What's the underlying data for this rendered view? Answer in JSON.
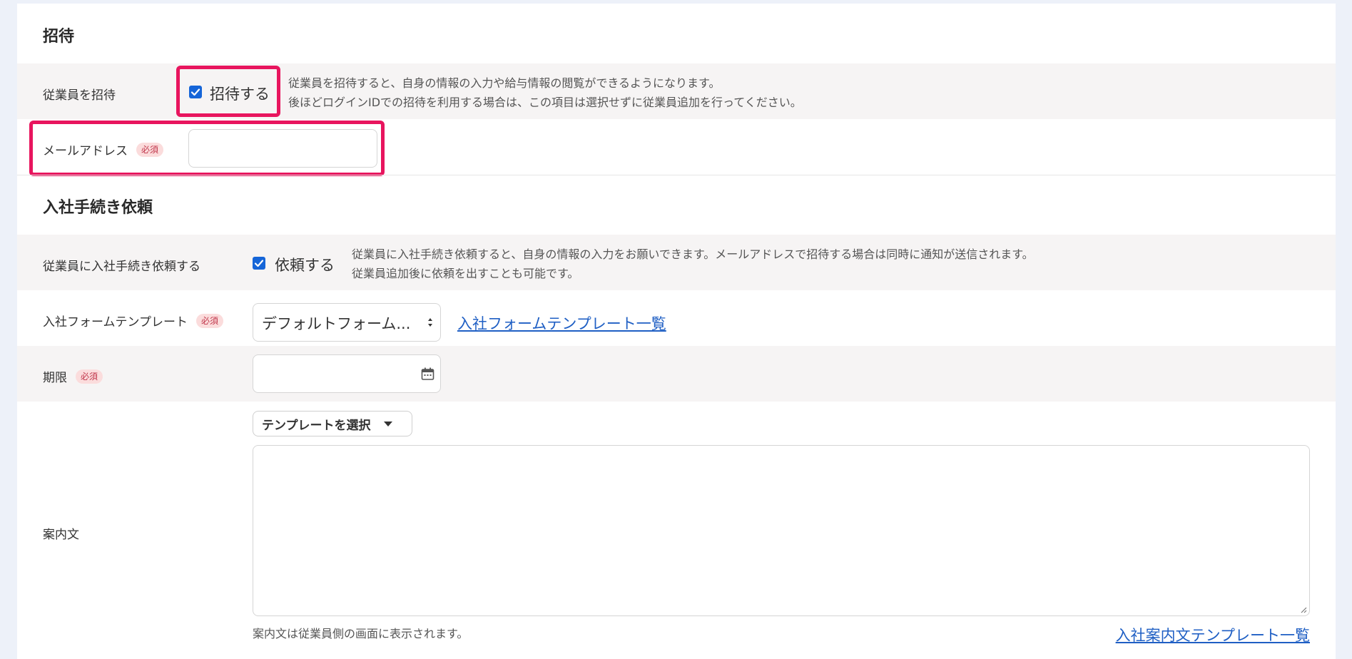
{
  "invite": {
    "section_title": "招待",
    "employee_label": "従業員を招待",
    "checkbox_label": "招待する",
    "help_line1": "従業員を招待すると、自身の情報の入力や給与情報の閲覧ができるようになります。",
    "help_line2": "後ほどログインIDでの招待を利用する場合は、この項目は選択せずに従業員追加を行ってください。",
    "email_label": "メールアドレス",
    "required": "必須",
    "email_value": ""
  },
  "onboarding": {
    "section_title": "入社手続き依頼",
    "request_label": "従業員に入社手続き依頼する",
    "checkbox_label": "依頼する",
    "help_line1": "従業員に入社手続き依頼すると、自身の情報の入力をお願いできます。メールアドレスで招待する場合は同時に通知が送信されます。",
    "help_line2": "従業員追加後に依頼を出すことも可能です。",
    "template_label": "入社フォームテンプレート",
    "template_value": "デフォルトフォーム...",
    "template_link": "入社フォームテンプレート一覧",
    "deadline_label": "期限",
    "deadline_value": "",
    "message_label": "案内文",
    "template_select_button": "テンプレートを選択",
    "message_value": "",
    "message_hint": "案内文は従業員側の画面に表示されます。",
    "message_template_link": "入社案内文テンプレート一覧"
  },
  "colors": {
    "highlight": "#e8155e",
    "checkbox": "#1565d8",
    "link": "#1f5fc4",
    "required_bg": "#fbdcdc"
  }
}
